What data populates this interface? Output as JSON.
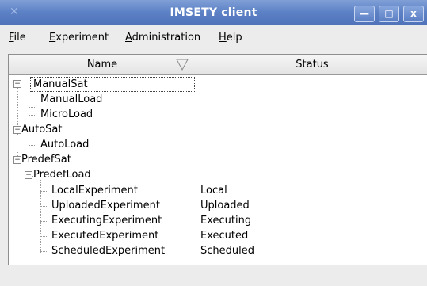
{
  "window": {
    "title": "IMSETY client",
    "controls": {
      "minimize": "—",
      "maximize": "□",
      "close": "x"
    }
  },
  "menu": [
    {
      "label": "File",
      "mnemonic": "F",
      "rest": "ile"
    },
    {
      "label": "Experiment",
      "mnemonic": "E",
      "rest": "xperiment"
    },
    {
      "label": "Administration",
      "mnemonic": "A",
      "rest": "dministration"
    },
    {
      "label": "Help",
      "mnemonic": "H",
      "rest": "elp"
    }
  ],
  "table": {
    "columns": {
      "name": "Name",
      "status": "Status"
    },
    "sort_icon": "sort-triangle-icon",
    "rows": [
      {
        "label": "ManualSat",
        "status": ""
      },
      {
        "label": "ManualLoad",
        "status": ""
      },
      {
        "label": "MicroLoad",
        "status": ""
      },
      {
        "label": "AutoSat",
        "status": ""
      },
      {
        "label": "AutoLoad",
        "status": ""
      },
      {
        "label": "PredefSat",
        "status": ""
      },
      {
        "label": "PredefLoad",
        "status": ""
      },
      {
        "label": "LocalExperiment",
        "status": "Local"
      },
      {
        "label": "UploadedExperiment",
        "status": "Uploaded"
      },
      {
        "label": "ExecutingExperiment",
        "status": "Executing"
      },
      {
        "label": "ExecutedExperiment",
        "status": "Executed"
      },
      {
        "label": "ScheduledExperiment",
        "status": "Scheduled"
      }
    ]
  }
}
